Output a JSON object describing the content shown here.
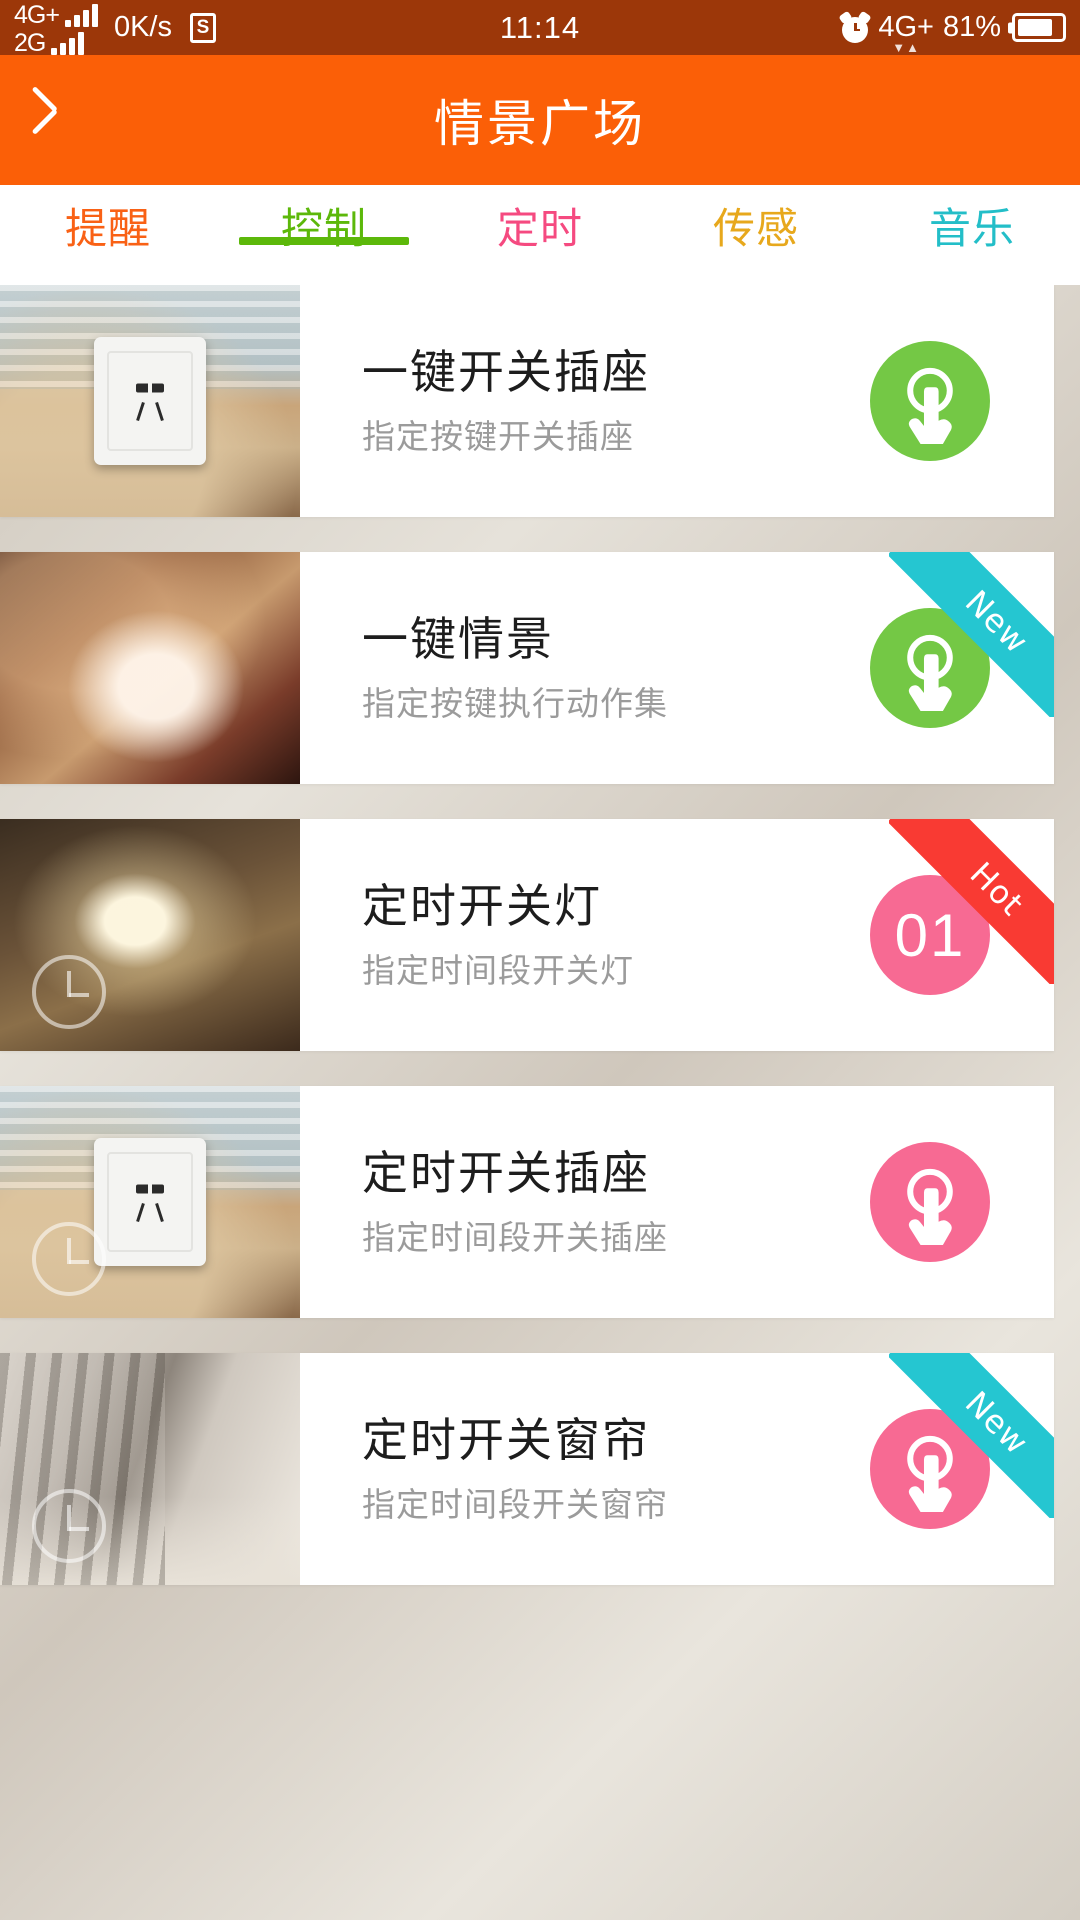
{
  "statusbar": {
    "sim1_label": "4G+",
    "sim2_label": "2G",
    "netspeed": "0K/s",
    "sim_badge": "S",
    "time": "11:14",
    "alarm_icon": "alarm-clock-icon",
    "network": "4G+",
    "data_arrows": "▼▲",
    "battery_percent": "81%"
  },
  "appbar": {
    "back_icon": "back-chevron-icon",
    "title": "情景广场",
    "bg_color": "#fb5f07"
  },
  "tabs": [
    {
      "label": "提醒",
      "color": "#f96115",
      "active": false
    },
    {
      "label": "控制",
      "color": "#5cb80a",
      "active": true
    },
    {
      "label": "定时",
      "color": "#f54a80",
      "active": false
    },
    {
      "label": "传感",
      "color": "#e7a81c",
      "active": false
    },
    {
      "label": "音乐",
      "color": "#23bec8",
      "active": false
    }
  ],
  "cards": [
    {
      "title": "一键开关插座",
      "subtitle": "指定按键开关插座",
      "badge_type": "touch",
      "badge_text": "",
      "badge_color": "#74c845",
      "ribbon": null,
      "ribbon_color": null,
      "thumb": "living-room-outlet-photo",
      "thumb_class": "bg-livingroom",
      "has_outlet": true,
      "has_clock_watermark": false
    },
    {
      "title": "一键情景",
      "subtitle": "指定按键执行动作集",
      "badge_type": "touch",
      "badge_text": "",
      "badge_color": "#74c845",
      "ribbon": "New",
      "ribbon_color": "#25c6d1",
      "thumb": "hand-holding-phone-photo",
      "thumb_class": "bg-hand",
      "has_outlet": false,
      "has_clock_watermark": false
    },
    {
      "title": "定时开关灯",
      "subtitle": "指定时间段开关灯",
      "badge_type": "number",
      "badge_text": "01",
      "badge_color": "#f76a93",
      "ribbon": "Hot",
      "ribbon_color": "#f93a33",
      "thumb": "pendant-lamp-photo",
      "thumb_class": "bg-lamp",
      "has_outlet": false,
      "has_clock_watermark": true
    },
    {
      "title": "定时开关插座",
      "subtitle": "指定时间段开关插座",
      "badge_type": "touch",
      "badge_text": "",
      "badge_color": "#f76a93",
      "ribbon": null,
      "ribbon_color": null,
      "thumb": "living-room-outlet-photo",
      "thumb_class": "bg-livingroom",
      "has_outlet": true,
      "has_clock_watermark": true
    },
    {
      "title": "定时开关窗帘",
      "subtitle": "指定时间段开关窗帘",
      "badge_type": "touch",
      "badge_text": "",
      "badge_color": "#f76a93",
      "ribbon": "New",
      "ribbon_color": "#25c6d1",
      "thumb": "bedroom-curtain-photo",
      "thumb_class": "bg-curtain",
      "has_outlet": false,
      "has_clock_watermark": true
    }
  ]
}
